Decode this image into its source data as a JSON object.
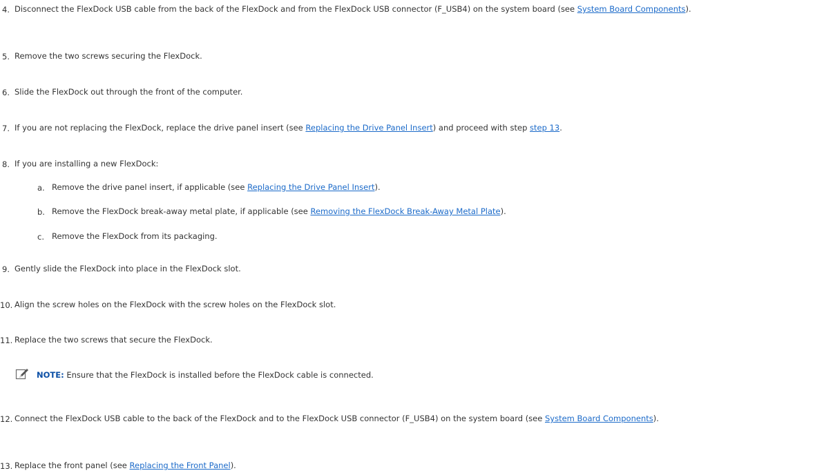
{
  "steps": {
    "s4": {
      "num": "4.",
      "pre": "Disconnect the FlexDock USB cable from the back of the FlexDock and from the FlexDock USB connector (F_USB4) on the system board (see ",
      "link": "System Board Components",
      "post": ")."
    },
    "s5": {
      "num": "5.",
      "text": "Remove the two screws securing the FlexDock."
    },
    "s6": {
      "num": "6.",
      "text": "Slide the FlexDock out through the front of the computer."
    },
    "s7": {
      "num": "7.",
      "pre": "If you are not replacing the FlexDock, replace the drive panel insert (see ",
      "link1": "Replacing the Drive Panel Insert",
      "mid": ") and proceed with step ",
      "link2": "step 13",
      "post": "."
    },
    "s8": {
      "num": "8.",
      "text": "If you are installing a new FlexDock:",
      "a": {
        "letter": "a.",
        "pre": "Remove the drive panel insert, if applicable (see ",
        "link": "Replacing the Drive Panel Insert",
        "post": ")."
      },
      "b": {
        "letter": "b.",
        "pre": "Remove the FlexDock break-away metal plate, if applicable (see ",
        "link": "Removing the FlexDock Break-Away Metal Plate",
        "post": ")."
      },
      "c": {
        "letter": "c.",
        "text": "Remove the FlexDock from its packaging."
      }
    },
    "s9": {
      "num": "9.",
      "text": "Gently slide the FlexDock into place in the FlexDock slot."
    },
    "s10": {
      "num": "10.",
      "text": "Align the screw holes on the FlexDock with the screw holes on the FlexDock slot."
    },
    "s11": {
      "num": "11.",
      "text": "Replace the two screws that secure the FlexDock."
    },
    "note": {
      "label": "NOTE:",
      "text": " Ensure that the FlexDock is installed before the FlexDock cable is connected."
    },
    "s12": {
      "num": "12.",
      "pre": "Connect the FlexDock USB cable to the back of the FlexDock and to the FlexDock USB connector (F_USB4) on the system board (see ",
      "link": "System Board Components",
      "post": ")."
    },
    "s13": {
      "num": "13.",
      "pre": "Replace the front panel (see ",
      "link": "Replacing the Front Panel",
      "post": ")."
    }
  }
}
